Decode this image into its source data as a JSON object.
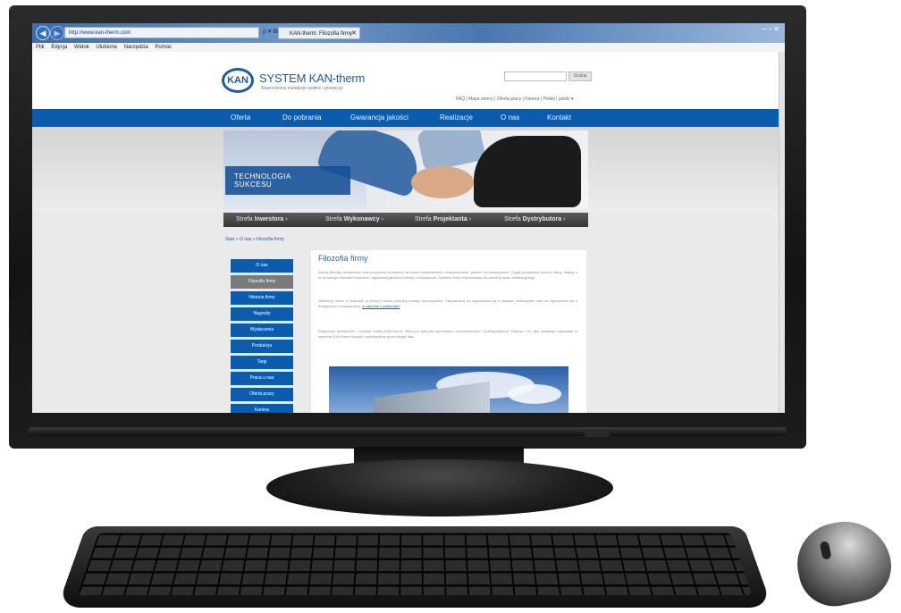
{
  "browser": {
    "address": "http://www.kan-therm.com",
    "tab_label": "KAN-therm: Filozofia firmy",
    "tab_close": "✕",
    "nav_icons": "ρ ▾ ⊠ C ✕",
    "window_controls": "─ ▫ ✕",
    "menu": [
      "Plik",
      "Edycja",
      "Widok",
      "Ulubione",
      "Narzędzia",
      "Pomoc"
    ]
  },
  "site": {
    "logo_mark": "KAN",
    "logo_text": "SYSTEM KAN-therm",
    "logo_sub": "Nowoczesne instalacje wodne i grzewcze",
    "search_button": "Szukaj",
    "top_links": "FAQ | Mapa strony | Oferta pracy | Kariera | Polski | polski ▾",
    "nav": [
      "Oferta",
      "Do pobrania",
      "Gwarancja jakości",
      "Realizacje",
      "O nas",
      "Kontakt"
    ],
    "hero_label": [
      "TECHNOLOGIA",
      "SUKCESU"
    ],
    "strefy": [
      {
        "prefix": "Strefa",
        "name": "Inwestora"
      },
      {
        "prefix": "Strefa",
        "name": "Wykonawcy"
      },
      {
        "prefix": "Strefa",
        "name": "Projektanta"
      },
      {
        "prefix": "Strefa",
        "name": "Dystrybutora"
      }
    ],
    "breadcrumb": "Start » O nas » Filozofia firmy",
    "sidebar": [
      "O nas",
      "Filozofia firmy",
      "Historia firmy",
      "Nagrody",
      "Wydarzenia",
      "Produkcja",
      "Targi",
      "Praca u nas",
      "Oferta pracy",
      "Kariera"
    ],
    "sidebar_active_index": 1,
    "content_title": "Filozofia firmy",
    "paragraphs": [
      "Naszą filozofię działalności oraz przyszłość budujemy na trzech fundamentach: doświadczeniu, jakości i innowacyjności. Ciągle podnosimy poziom oferty, dbając o to by naszym klientom zapewnić najwyższej jakości produkty i rozwiązania. Systemy firmy odpowiadają na potrzeby rynku instalacyjnego.",
      "Jesteśmy dumni z realizacji, w których nasze produkty zostały wykorzystane. Zapraszamy do zapoznania się z naszymi realizacjami oraz do zapoznania się z dostępnymi rozwiązaniami.",
      "Pragniemy wzmacniać i rozwijać markę KAN-therm, która już dziś jest synonimem nowoczesności i profesjonalizmu. Dbamy o to, aby instalacje wykonane w systemie KAN-therm służyły użytkownikom przez długie lata."
    ],
    "paragraph2_link": "w zakresie z partnerami"
  }
}
